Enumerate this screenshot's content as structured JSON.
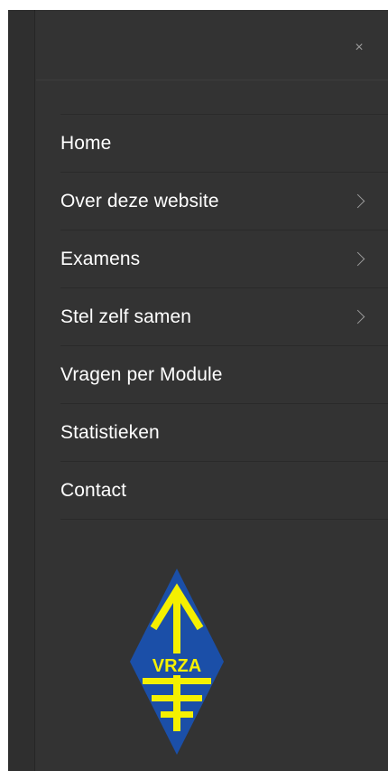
{
  "close": {
    "symbol": "×"
  },
  "menu": {
    "items": [
      {
        "label": "Home",
        "has_submenu": false
      },
      {
        "label": "Over deze website",
        "has_submenu": true
      },
      {
        "label": "Examens",
        "has_submenu": true
      },
      {
        "label": "Stel zelf samen",
        "has_submenu": true
      },
      {
        "label": "Vragen per Module",
        "has_submenu": false
      },
      {
        "label": "Statistieken",
        "has_submenu": false
      },
      {
        "label": "Contact",
        "has_submenu": false
      }
    ]
  },
  "logo": {
    "text": "VRZA"
  },
  "colors": {
    "panel": "#333333",
    "text": "#ffffff",
    "muted": "#9a9a9a",
    "logo_blue": "#1b4fa8",
    "logo_yellow": "#f5f000"
  }
}
